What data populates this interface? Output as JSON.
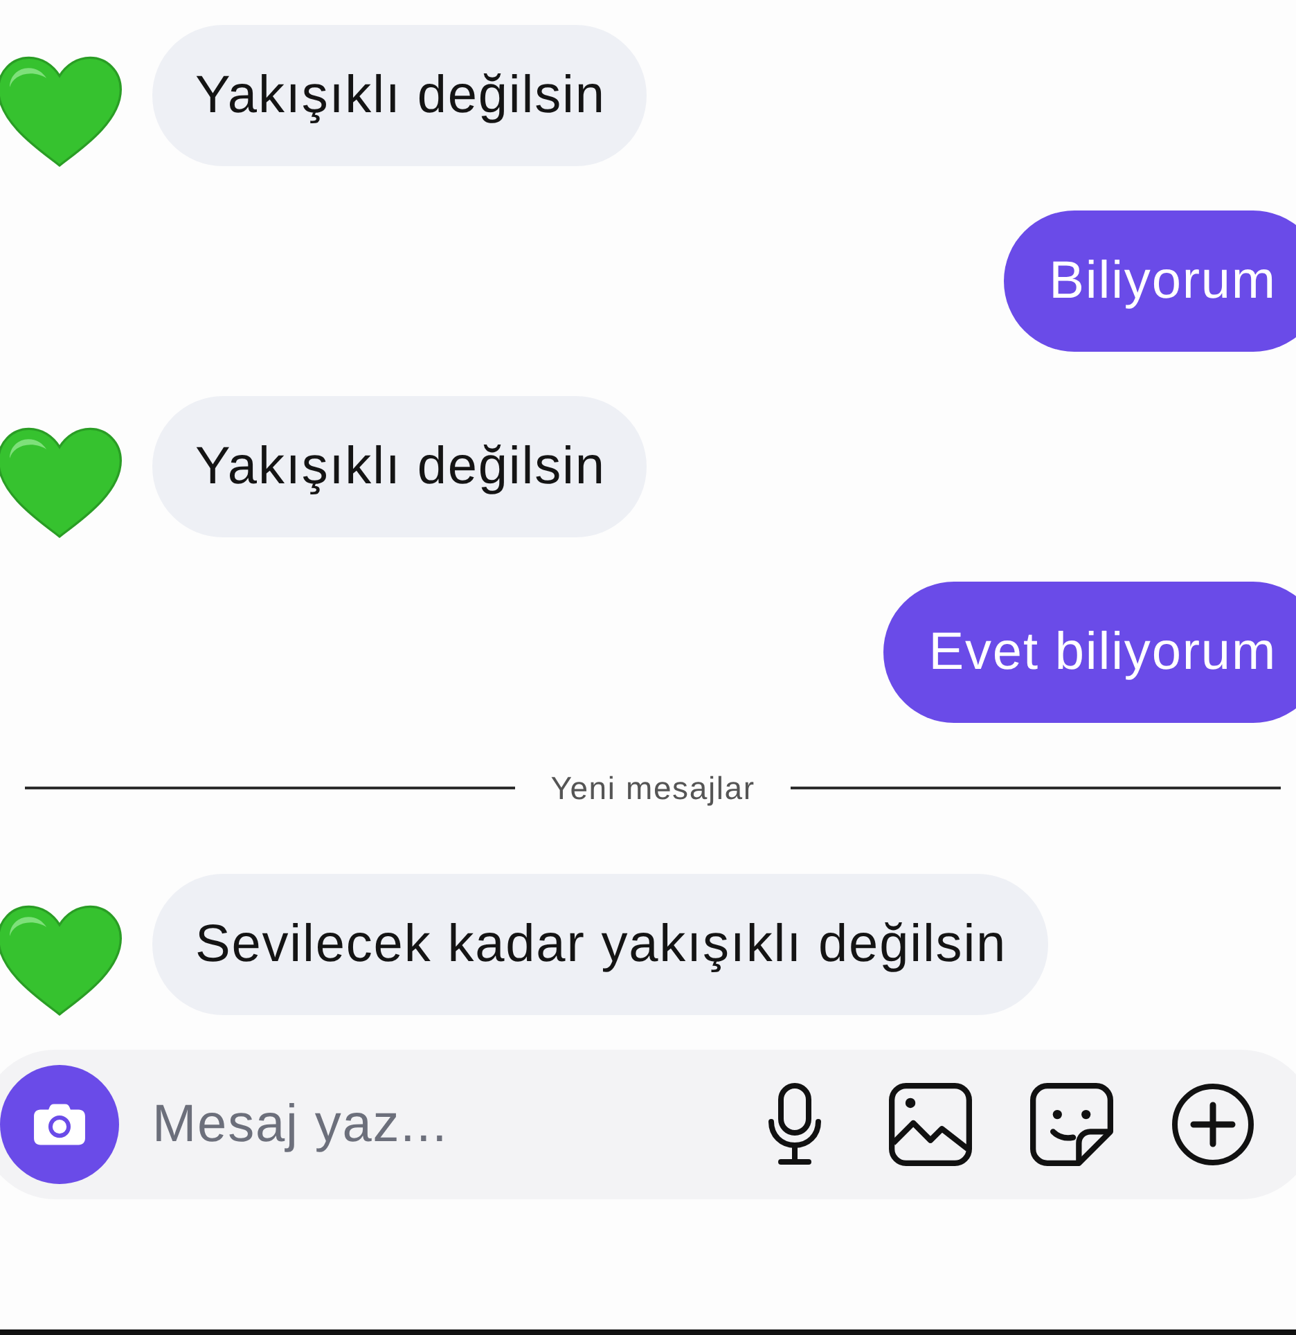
{
  "messages": [
    {
      "kind": "incoming",
      "text": "Yakışıklı değilsin"
    },
    {
      "kind": "outgoing",
      "text": "Biliyorum"
    },
    {
      "kind": "incoming",
      "text": "Yakışıklı değilsin"
    },
    {
      "kind": "outgoing",
      "text": "Evet biliyorum"
    },
    {
      "kind": "divider",
      "text": "Yeni mesajlar"
    },
    {
      "kind": "incoming",
      "text": "Sevilecek kadar yakışıklı değilsin"
    }
  ],
  "composer": {
    "placeholder": "Mesaj yaz..."
  }
}
